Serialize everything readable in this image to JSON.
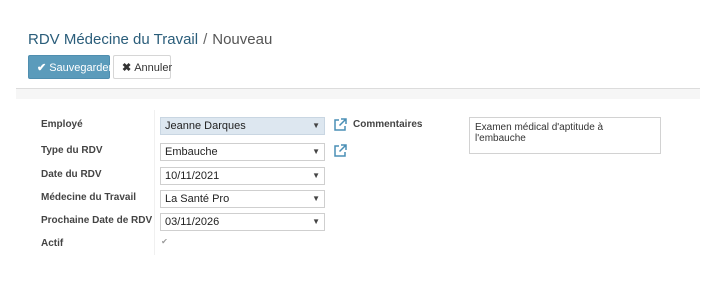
{
  "breadcrumb": {
    "parent": "RDV Médecine du Travail",
    "separator": "/",
    "current": "Nouveau"
  },
  "buttons": {
    "save": "Sauvegarder",
    "cancel": "Annuler"
  },
  "form": {
    "employee": {
      "label": "Employé",
      "value": "Jeanne Darques"
    },
    "type": {
      "label": "Type du RDV",
      "value": "Embauche"
    },
    "date": {
      "label": "Date du RDV",
      "value": "10/11/2021"
    },
    "medecine": {
      "label": "Médecine du Travail",
      "value": "La Santé Pro"
    },
    "next_date": {
      "label": "Prochaine Date de RDV",
      "value": "03/11/2026"
    },
    "active": {
      "label": "Actif",
      "checked": true
    },
    "comments": {
      "label": "Commentaires",
      "value": "Examen médical d'aptitude à l'embauche"
    }
  },
  "icons": {
    "save": "check-icon",
    "cancel": "close-icon",
    "dropdown": "caret-down-icon",
    "external": "external-link-icon"
  },
  "colors": {
    "primary": "#5b9bbb",
    "breadcrumb_link": "#2a5d7a",
    "selected_field": "#dde7f0"
  }
}
